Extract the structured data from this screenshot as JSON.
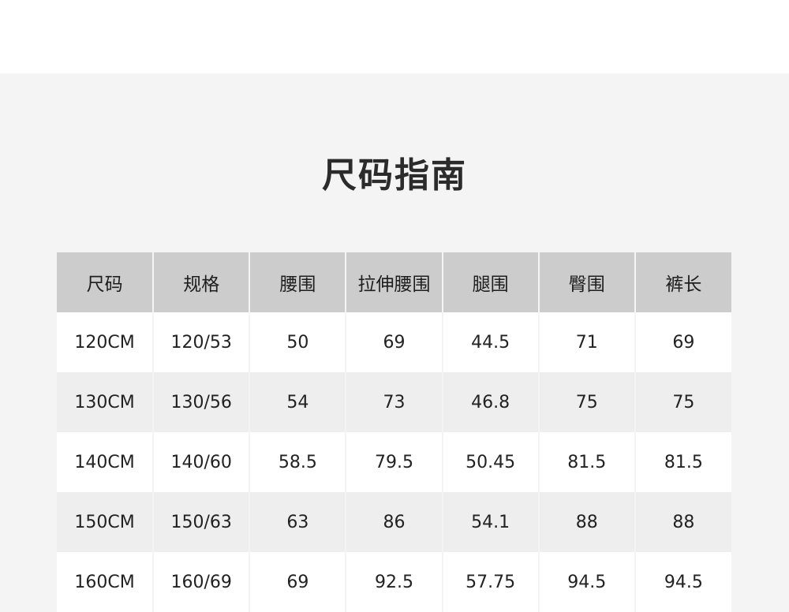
{
  "title": "尺码指南",
  "table": {
    "headers": [
      "尺码",
      "规格",
      "腰围",
      "拉伸腰围",
      "腿围",
      "臀围",
      "裤长"
    ],
    "rows": [
      [
        "120CM",
        "120/53",
        "50",
        "69",
        "44.5",
        "71",
        "69"
      ],
      [
        "130CM",
        "130/56",
        "54",
        "73",
        "46.8",
        "75",
        "75"
      ],
      [
        "140CM",
        "140/60",
        "58.5",
        "79.5",
        "50.45",
        "81.5",
        "81.5"
      ],
      [
        "150CM",
        "150/63",
        "63",
        "86",
        "54.1",
        "88",
        "88"
      ],
      [
        "160CM",
        "160/69",
        "69",
        "92.5",
        "57.75",
        "94.5",
        "94.5"
      ]
    ]
  }
}
